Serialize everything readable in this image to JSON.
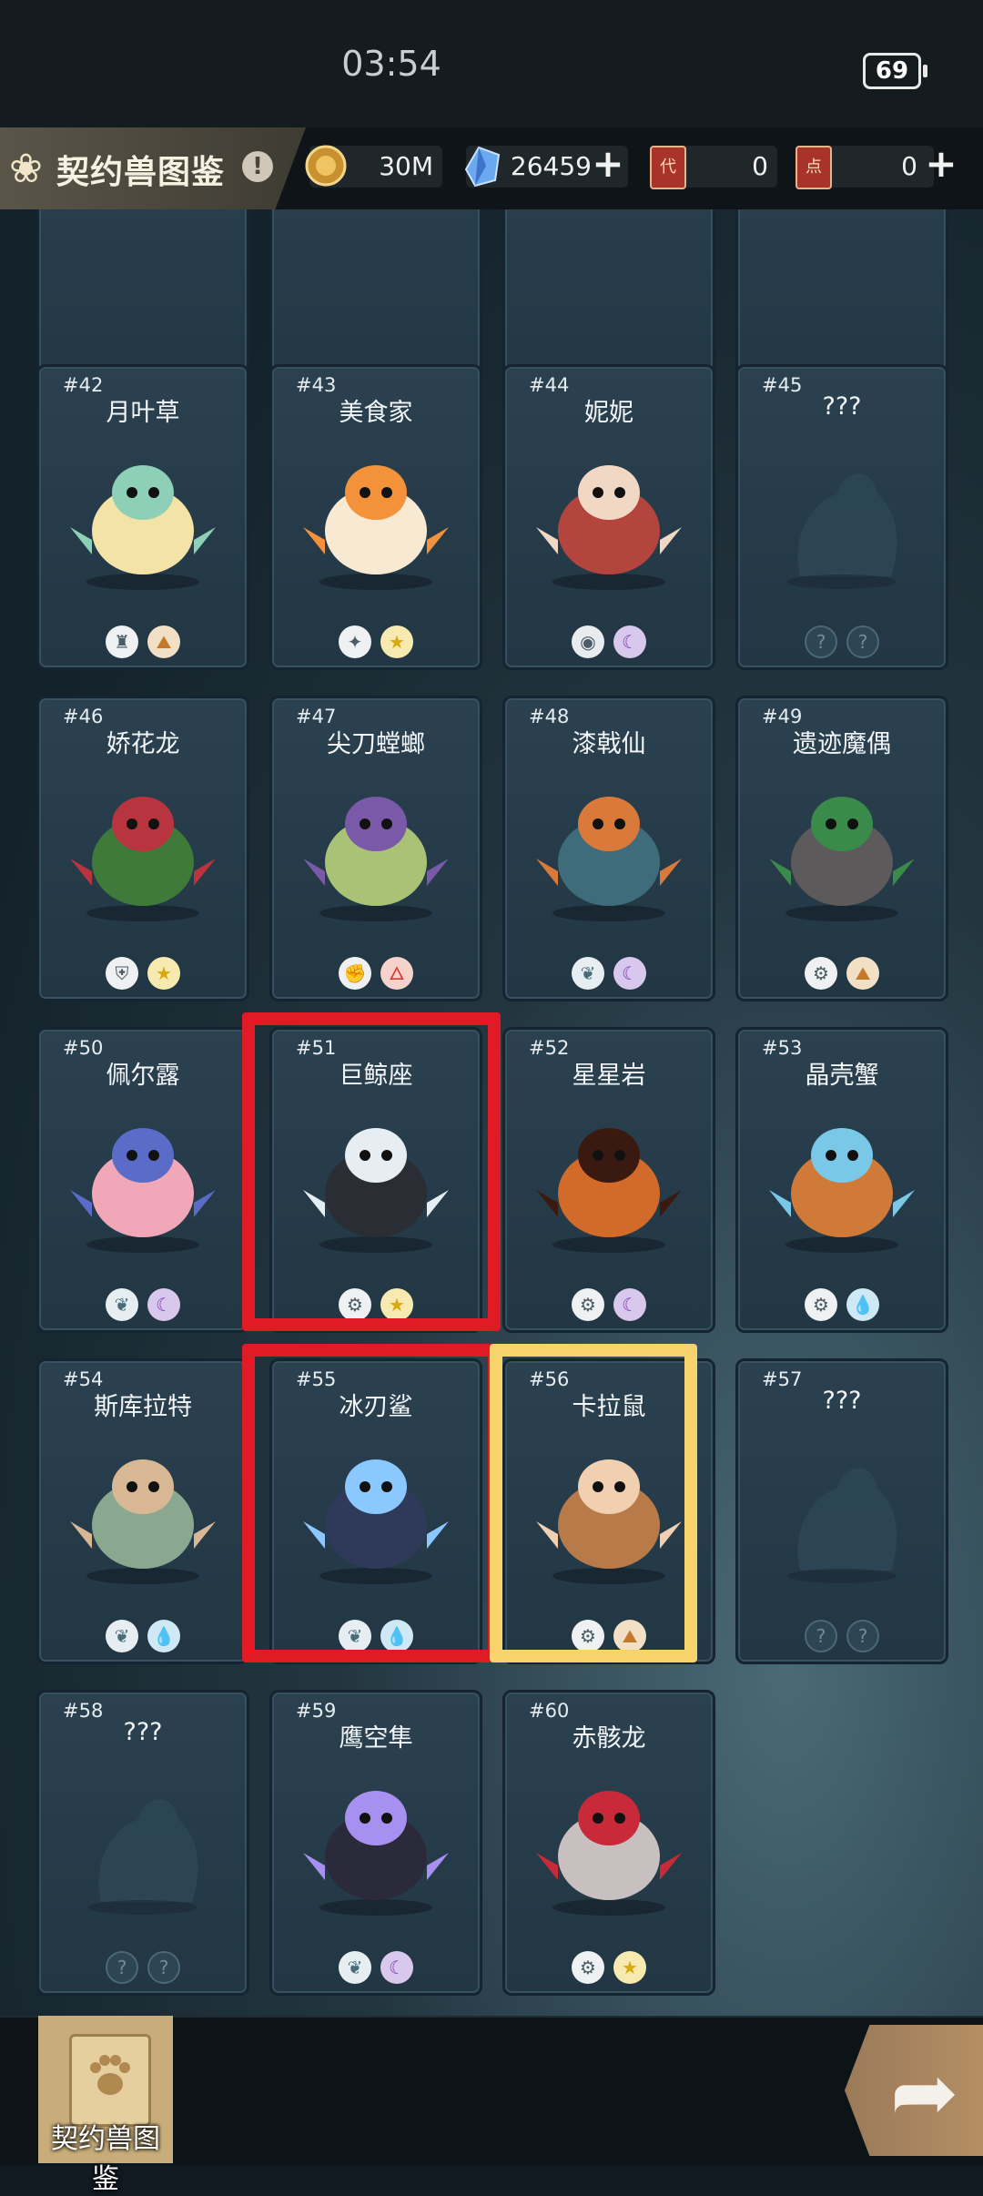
{
  "status_bar": {
    "time": "03:54",
    "battery": "69"
  },
  "header": {
    "title": "契约兽图鉴",
    "info_icon": "!",
    "resources": [
      {
        "icon": "gold-coin-icon",
        "value": "30M"
      },
      {
        "icon": "crystal-icon",
        "value": "26459",
        "has_plus": true
      },
      {
        "icon": "ticket-red-icon",
        "value": "0",
        "tag": "代"
      },
      {
        "icon": "ticket-red2-icon",
        "value": "0",
        "tag": "点",
        "has_plus": true
      }
    ],
    "plus": "+"
  },
  "partial_row_icons": [
    [
      "eye-icon",
      "moon-icon"
    ],
    [
      "eye-icon",
      "moon-icon"
    ],
    [
      "fist-icon",
      "earth-icon"
    ],
    [
      "unknown-icon",
      "unknown-icon"
    ]
  ],
  "cards": [
    {
      "num": "#42",
      "name": "月叶草",
      "icons": [
        "totem-icon",
        "earth-icon"
      ],
      "art": "plant"
    },
    {
      "num": "#43",
      "name": "美食家",
      "icons": [
        "target-icon",
        "star-icon"
      ],
      "art": "dessert"
    },
    {
      "num": "#44",
      "name": "妮妮",
      "icons": [
        "eye-icon",
        "moon-icon"
      ],
      "art": "jelly"
    },
    {
      "num": "#45",
      "name": "???",
      "icons": [
        "unknown-icon",
        "unknown-icon"
      ],
      "art": "silhouette"
    },
    {
      "num": "#46",
      "name": "娇花龙",
      "icons": [
        "shield-icon",
        "star-icon"
      ],
      "art": "flowerdragon"
    },
    {
      "num": "#47",
      "name": "尖刀螳螂",
      "icons": [
        "fist-icon",
        "fire-icon"
      ],
      "art": "mantis"
    },
    {
      "num": "#48",
      "name": "漆戟仙",
      "icons": [
        "leaf-icon",
        "moon-icon"
      ],
      "art": "turtle"
    },
    {
      "num": "#49",
      "name": "遗迹魔偶",
      "icons": [
        "gear-icon",
        "earth-icon"
      ],
      "art": "golem"
    },
    {
      "num": "#50",
      "name": "佩尔露",
      "icons": [
        "leaf-icon",
        "moon-icon"
      ],
      "art": "pearl"
    },
    {
      "num": "#51",
      "name": "巨鲸座",
      "icons": [
        "gear-icon",
        "star-icon"
      ],
      "art": "whale"
    },
    {
      "num": "#52",
      "name": "星星岩",
      "icons": [
        "gear-icon",
        "moon-icon"
      ],
      "art": "star"
    },
    {
      "num": "#53",
      "name": "晶壳蟹",
      "icons": [
        "gear-icon",
        "water-icon"
      ],
      "art": "crab"
    },
    {
      "num": "#54",
      "name": "斯库拉特",
      "icons": [
        "leaf-icon",
        "water-icon"
      ],
      "art": "serpent"
    },
    {
      "num": "#55",
      "name": "冰刃鲨",
      "icons": [
        "leaf-icon",
        "water-icon"
      ],
      "art": "shark"
    },
    {
      "num": "#56",
      "name": "卡拉鼠",
      "icons": [
        "gear-icon",
        "earth-icon"
      ],
      "art": "mole"
    },
    {
      "num": "#57",
      "name": "???",
      "icons": [
        "unknown-icon",
        "unknown-icon"
      ],
      "art": "silhouette"
    },
    {
      "num": "#58",
      "name": "???",
      "icons": [
        "unknown-icon",
        "unknown-icon"
      ],
      "art": "silhouette"
    },
    {
      "num": "#59",
      "name": "鹰空隼",
      "icons": [
        "leaf-icon",
        "moon-icon"
      ],
      "art": "bird"
    },
    {
      "num": "#60",
      "name": "赤骸龙",
      "icons": [
        "gear-icon",
        "star-icon"
      ],
      "art": "bonedragon"
    }
  ],
  "highlights": {
    "red": [
      "#51",
      "#55"
    ],
    "yellow": [
      "#56"
    ]
  },
  "bottom": {
    "book_label": "契约兽图鉴",
    "next_icon": "arrow-right-icon"
  },
  "colors": {
    "highlight_red": "#e01b26",
    "highlight_yellow": "#f7d36b",
    "card_bg": "#2b4150"
  }
}
